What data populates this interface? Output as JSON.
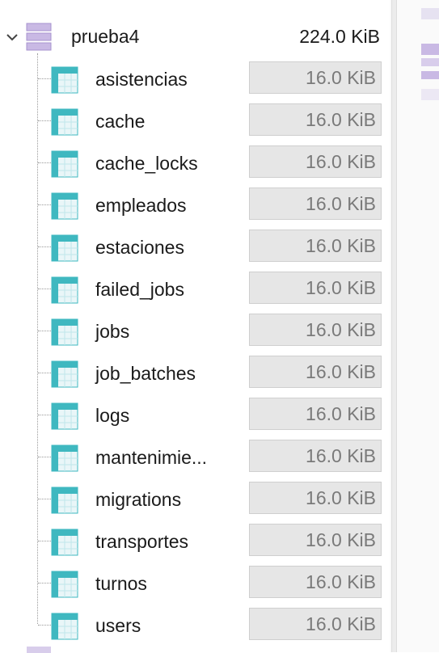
{
  "database": {
    "name": "prueba4",
    "size": "224.0 KiB",
    "expanded_icon": "chevron-down-icon",
    "icon": "database-icon"
  },
  "tables": [
    {
      "name": "asistencias",
      "size": "16.0 KiB"
    },
    {
      "name": "cache",
      "size": "16.0 KiB"
    },
    {
      "name": "cache_locks",
      "size": "16.0 KiB"
    },
    {
      "name": "empleados",
      "size": "16.0 KiB"
    },
    {
      "name": "estaciones",
      "size": "16.0 KiB"
    },
    {
      "name": "failed_jobs",
      "size": "16.0 KiB"
    },
    {
      "name": "jobs",
      "size": "16.0 KiB"
    },
    {
      "name": "job_batches",
      "size": "16.0 KiB"
    },
    {
      "name": "logs",
      "size": "16.0 KiB"
    },
    {
      "name": "mantenimie...",
      "size": "16.0 KiB"
    },
    {
      "name": "migrations",
      "size": "16.0 KiB"
    },
    {
      "name": "transportes",
      "size": "16.0 KiB"
    },
    {
      "name": "turnos",
      "size": "16.0 KiB"
    },
    {
      "name": "users",
      "size": "16.0 KiB"
    }
  ],
  "colors": {
    "database_icon": "#b9a6d9",
    "table_icon_header": "#3fb8c0",
    "table_icon_body": "#e9f6f8",
    "size_box_bg": "#e6e6e6"
  }
}
